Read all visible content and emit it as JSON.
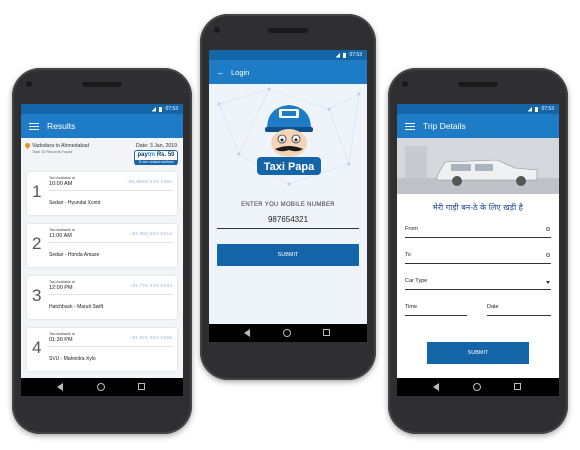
{
  "status": {
    "time": "07:53"
  },
  "colors": {
    "primary": "#1e7cc6",
    "dark_primary": "#1464a8",
    "paytm_blue": "#1d9be0",
    "pin_orange": "#e2951b"
  },
  "results": {
    "title": "Results",
    "route": "Vadodara to Ahmedabad",
    "date": "Date: 3 Jan, 2019",
    "total": "Total 10 Records Found",
    "paytm": {
      "brand_a": "pay",
      "brand_b": "tm",
      "amount": " Rs. 50",
      "sub": "To see contact numbers"
    },
    "items": [
      {
        "num": "1",
        "avail": "Taxi Available at",
        "time": "10:00 AM",
        "phone": "+91 99XX XXX XX04",
        "car": "Sedan - Hyundai Xcent"
      },
      {
        "num": "2",
        "avail": "Taxi Available at",
        "time": "11:00 AM",
        "phone": "+91 65X XXX XX14",
        "car": "Sedan - Honda Amaze"
      },
      {
        "num": "3",
        "avail": "Taxi Available at",
        "time": "12:00 PM",
        "phone": "+91 77X XXX XX23",
        "car": "Hatchback - Maruti Swift"
      },
      {
        "num": "4",
        "avail": "Taxi Available at",
        "time": "01:30 PM",
        "phone": "+91 87X XXX XX58",
        "car": "SVU - Mahindra Xylo"
      }
    ]
  },
  "login": {
    "title": "Login",
    "logo_text": "Taxi Papa",
    "label": "ENTER YOU MOBILE NUMBER",
    "mobile": "987654321",
    "submit": "SUBMIT"
  },
  "trip": {
    "title": "Trip Details",
    "tagline": "मेरी गाड़ी बन-ठे के लिए खड़ी है",
    "from": "From",
    "to": "To",
    "car_type": "Car Type",
    "time": "Time",
    "date": "Date",
    "submit": "SUBMIT"
  }
}
